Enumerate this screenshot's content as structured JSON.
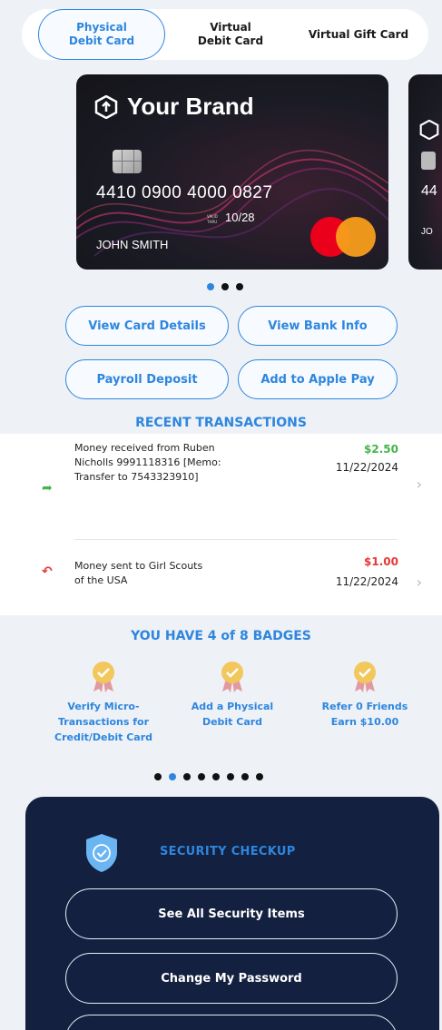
{
  "tabs": [
    {
      "label_line1": "Physical",
      "label_line2": "Debit Card"
    },
    {
      "label_line1": "Virtual",
      "label_line2": "Debit Card"
    },
    {
      "label": "Virtual Gift Card"
    }
  ],
  "card": {
    "brand": "Your Brand",
    "number": "4410 0900 4000 0827",
    "valid_thru_label": "VALID THRU",
    "expiry": "10/28",
    "holder": "JOHN SMITH",
    "network_icon": "mastercard-logo",
    "peek_letters": "44",
    "peek_holder": "JO"
  },
  "buttons": {
    "view_card_details": "View Card Details",
    "view_bank_info": "View Bank Info",
    "payroll_deposit": "Payroll Deposit",
    "add_apple_pay": "Add to Apple Pay"
  },
  "transactions": {
    "title": "RECENT TRANSACTIONS",
    "items": [
      {
        "description": "Money received from Ruben Nicholls 9991118316 [Memo: Transfer to 7543323910]",
        "amount": "$2.50",
        "date": "11/22/2024",
        "direction": "in",
        "color": "#43b54a"
      },
      {
        "description": "Money sent to Girl Scouts of the USA",
        "amount": "$1.00",
        "date": "11/22/2024",
        "direction": "out",
        "color": "#e53935"
      }
    ]
  },
  "badges": {
    "title": "YOU HAVE 4 of 8  BADGES",
    "items": [
      {
        "label": "Verify Micro-Transactions for Credit/Debit Card"
      },
      {
        "label": "Add a Physical Debit Card"
      },
      {
        "label": "Refer 0 Friends Earn $10.00"
      }
    ]
  },
  "security": {
    "title": "SECURITY CHECKUP",
    "buttons": [
      "See All Security Items",
      "Change My Password"
    ]
  },
  "colors": {
    "accent": "#2e86de",
    "navy": "#13203f",
    "positive": "#43b54a",
    "negative": "#e53935"
  }
}
